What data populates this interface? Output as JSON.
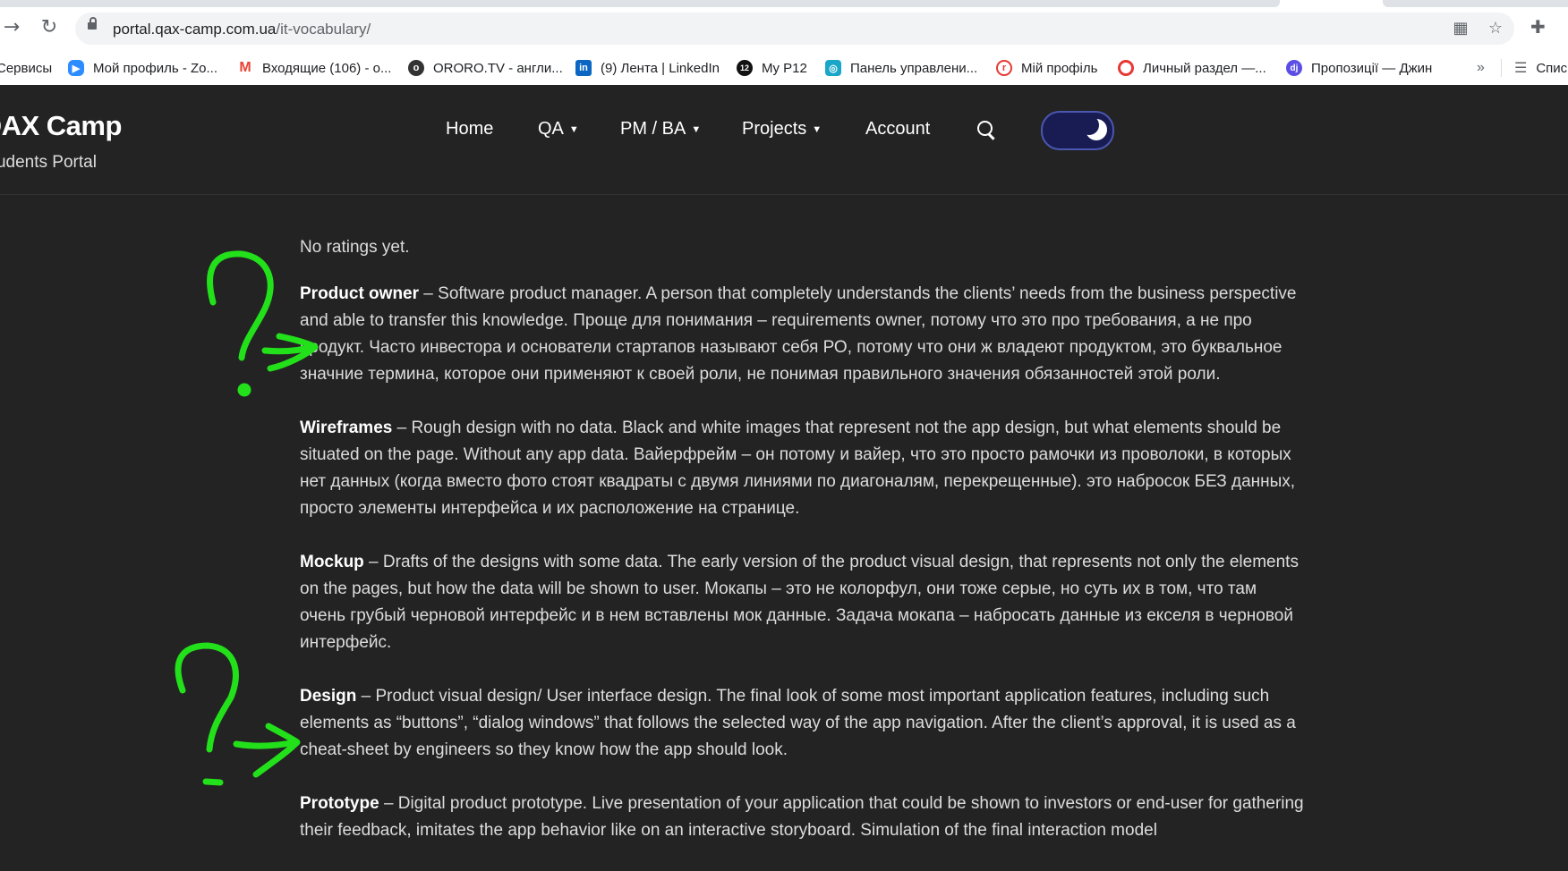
{
  "browser": {
    "url_host": "portal.qax-camp.com.ua",
    "url_path": "/it-vocabulary/",
    "bookmarks": [
      {
        "label": "Сервисы",
        "icon": "apps-grid-icon",
        "color": "#4285f4"
      },
      {
        "label": "Мой профиль - Zo...",
        "icon": "zoom-icon",
        "color": "#2d8cff"
      },
      {
        "label": "Входящие (106) - o...",
        "icon": "gmail-icon",
        "color": "#ea4335"
      },
      {
        "label": "ORORO.TV - англи...",
        "icon": "ororo-icon",
        "color": "#333333"
      },
      {
        "label": "(9) Лента | LinkedIn",
        "icon": "linkedin-icon",
        "color": "#0a66c2"
      },
      {
        "label": "My P12",
        "icon": "p12-icon",
        "color": "#111111"
      },
      {
        "label": "Панель управлени...",
        "icon": "panel-icon",
        "color": "#1aa6c8"
      },
      {
        "label": "Мій профіль",
        "icon": "profile-icon",
        "color": "#e53935"
      },
      {
        "label": "Личный раздел —...",
        "icon": "target-icon",
        "color": "#e53935"
      },
      {
        "label": "Пропозиції — Джин",
        "icon": "djinni-icon",
        "color": "#5c4ee5"
      }
    ],
    "bookmarks_more": "»",
    "reading_list": "Спис"
  },
  "site": {
    "title": "QAX Camp",
    "tagline": "Students Portal",
    "menu": [
      {
        "label": "Home",
        "dropdown": false
      },
      {
        "label": "QA",
        "dropdown": true
      },
      {
        "label": "PM / BA",
        "dropdown": true
      },
      {
        "label": "Projects",
        "dropdown": true
      },
      {
        "label": "Account",
        "dropdown": false
      }
    ],
    "theme": "dark"
  },
  "content": {
    "rating": "No ratings yet.",
    "entries": [
      {
        "term": "Product owner",
        "definition": " – Software product manager. A person that completely understands the clients’ needs from the business perspective and able to transfer this knowledge. Проще для понимания – requirements owner, потому что это про требования, а не про продукт. Часто инвестора и основатели стартапов называют себя РО, потому что они ж владеют продуктом, это буквальное значние термина, которое они применяют к своей роли, не понимая правильного значения обязанностей этой роли."
      },
      {
        "term": "Wireframes",
        "definition": " – Rough design with no data. Black and white images that represent not the app design, but what elements should be situated on the page. Without any app data. Вайерфрейм – он потому и вайер, что это просто рамочки из проволоки, в которых нет данных (когда вместо фото стоят квадраты с двумя линиями по диагоналям, перекрещенные). это набросок БЕЗ данных, просто элементы интерфейса и их расположение на странице."
      },
      {
        "term": "Mockup",
        "definition": " – Drafts of the designs with some data. The early version of the product visual design, that represents not only the elements on the pages, but how the data will be shown to user. Мокапы – это не колорфул, они тоже серые, но суть их в том, что там очень грубый черновой интерфейс и в нем вставлены мок данные. Задача мокапа – набросать данные из екселя в черновой интерфейс."
      },
      {
        "term": "Design",
        "definition": " – Product visual design/ User interface design. The final look of some most important application features, including such elements as “buttons”, “dialog windows” that follows the selected way of the app navigation. After the client’s approval, it is used as a cheat-sheet by engineers so they know how the app should look."
      },
      {
        "term": "Prototype",
        "definition": " – Digital product prototype. Live presentation of your application that could be shown to investors or end-user for gathering their feedback, imitates the app behavior like on an interactive storyboard. Simulation of the final interaction model"
      }
    ]
  },
  "colors": {
    "page_bg": "#232323",
    "text": "#dcdcdc",
    "annotation": "#22e01a",
    "toggle_bg": "#181c52"
  }
}
